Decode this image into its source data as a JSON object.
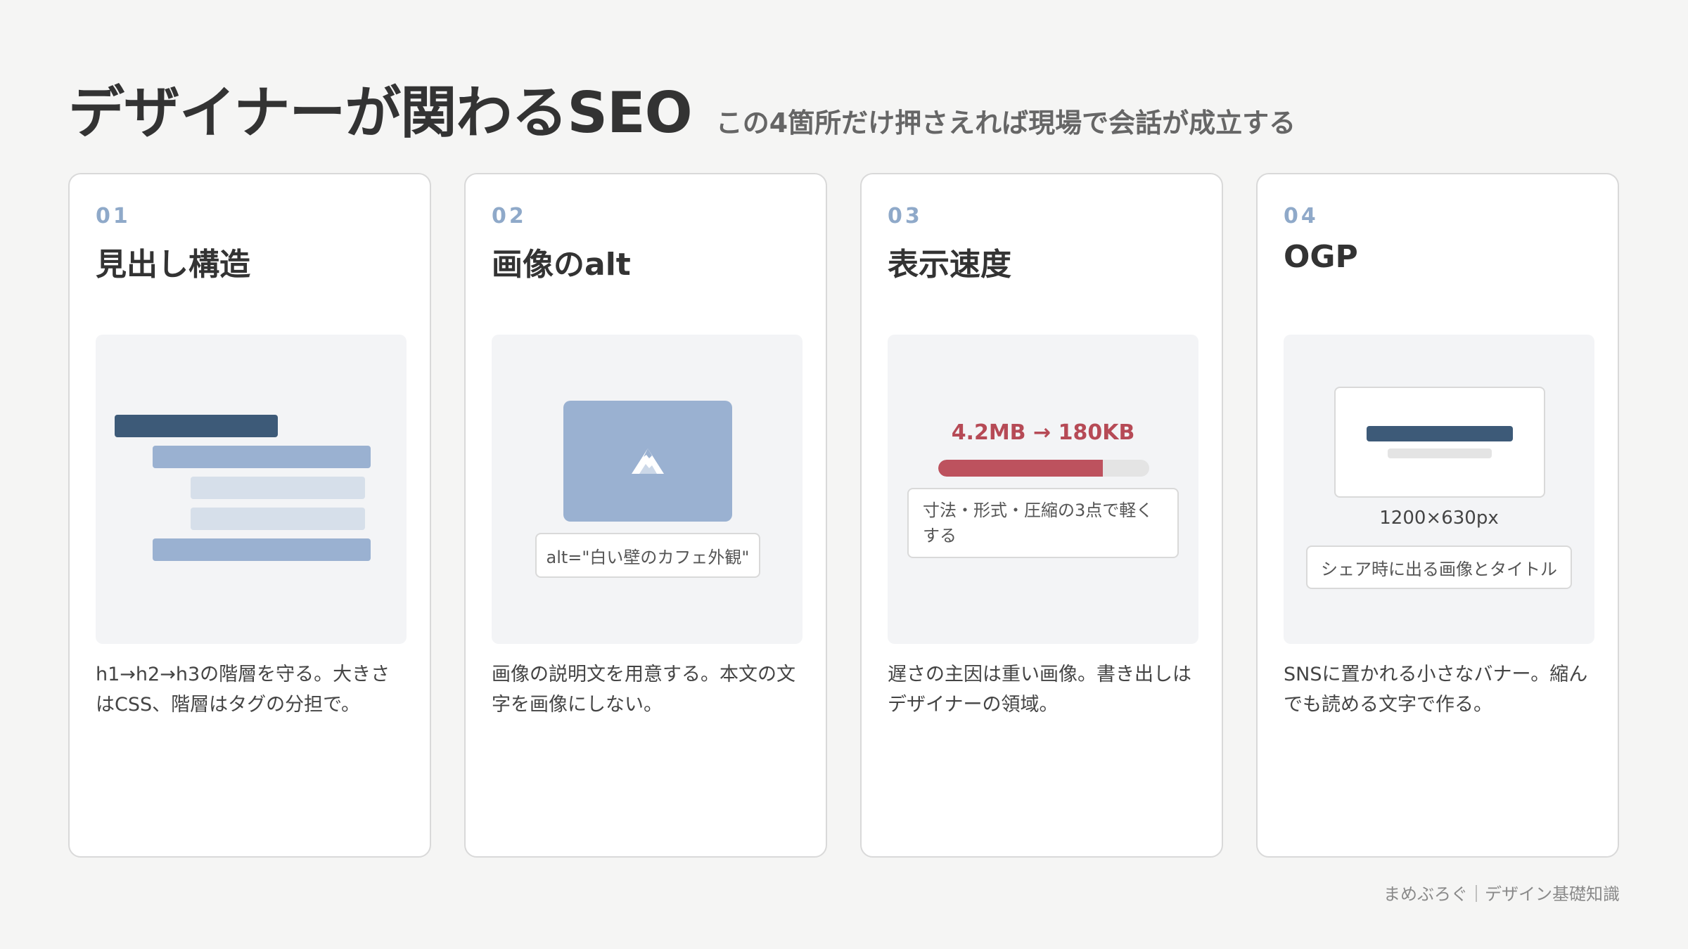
{
  "header": {
    "title": "デザイナーが関わるSEO",
    "subtitle": "この4箇所だけ押さえれば現場で会話が成立する"
  },
  "cards": [
    {
      "number": "01",
      "title": "見出し構造",
      "description": "h1→h2→h3の階層を守る。大きさはCSS、階層はタグの分担で。"
    },
    {
      "number": "02",
      "title": "画像のalt",
      "alt_example": "alt=\"白い壁のカフェ外観\"",
      "image_icon": "mountain-icon",
      "description": "画像の説明文を用意する。本文の文字を画像にしない。"
    },
    {
      "number": "03",
      "title": "表示速度",
      "speed_label": "4.2MB → 180KB",
      "speed_progress": 0.78,
      "speed_note": "寸法・形式・圧縮の3点で軽くする",
      "description": "遅さの主因は重い画像。書き出しはデザイナーの領域。"
    },
    {
      "number": "04",
      "title": "OGP",
      "size": "1200×630px",
      "tag": "シェア時に出る画像とタイトル",
      "description": "SNSに置かれる小さなバナー。縮んでも読める文字で作る。"
    }
  ],
  "footer": "まめぶろぐ｜デザイン基礎知識",
  "colors": {
    "accent_dark": "#3d5a78",
    "accent_mid": "#9ab1d1",
    "accent_light": "#d6dfea",
    "speed_red": "#bd525e"
  }
}
